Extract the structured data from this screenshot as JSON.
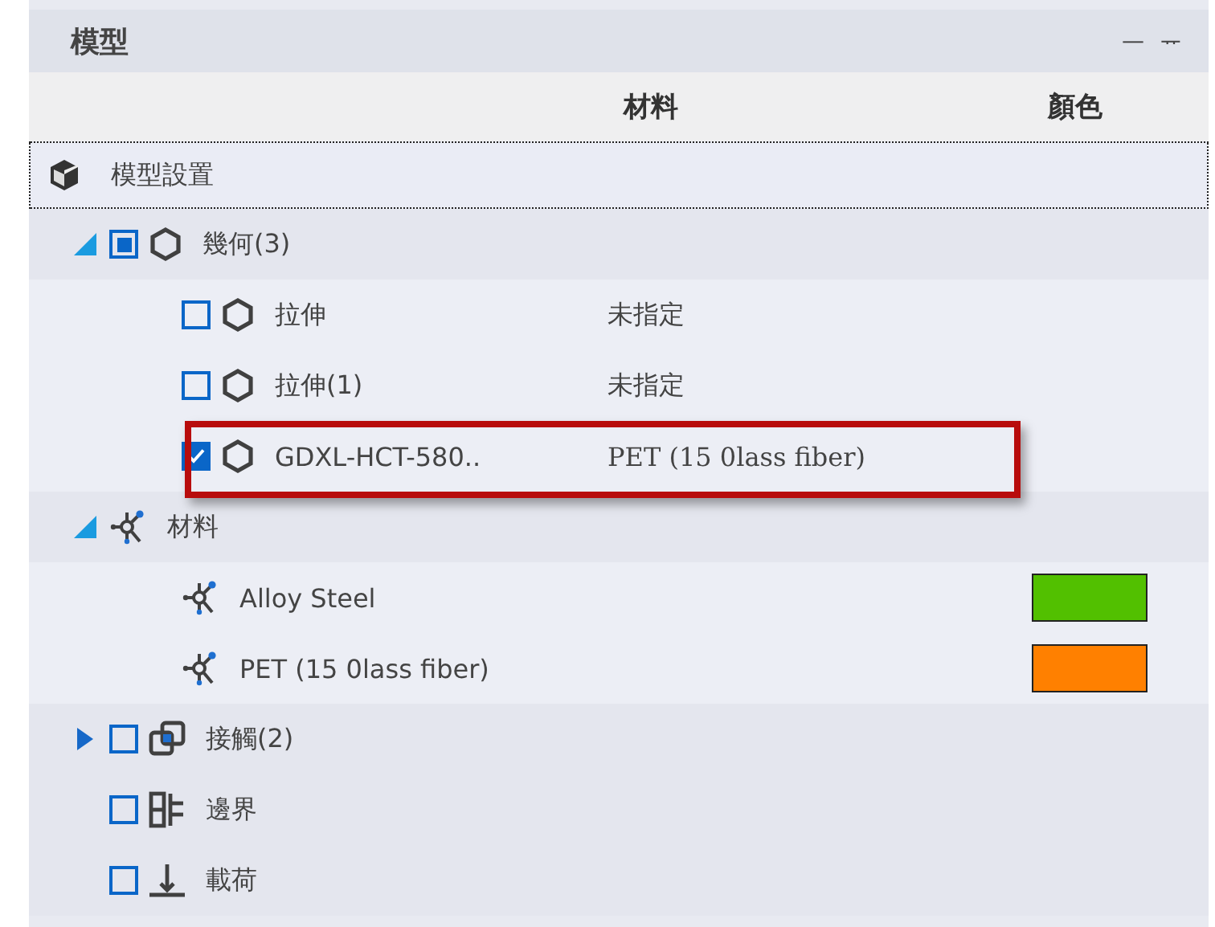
{
  "panel": {
    "title": "模型",
    "minimize_glyph": "—",
    "pin_glyph": "ᅲ"
  },
  "columns": [
    {
      "label": "材料"
    },
    {
      "label": "顏色"
    }
  ],
  "root": {
    "label": "模型設置",
    "selected": true
  },
  "tree": [
    {
      "label": "幾何(3)",
      "kind": "geometry",
      "checked": true,
      "partial": true,
      "expanded": true,
      "children": [
        {
          "label": "拉伸",
          "kind": "geometry",
          "checked": false,
          "partial": false,
          "material": "未指定",
          "highlighted": false
        },
        {
          "label": "拉伸(1)",
          "kind": "geometry",
          "checked": false,
          "partial": false,
          "material": "未指定",
          "highlighted": false
        },
        {
          "label": "GDXL-HCT-580..",
          "kind": "geometry",
          "checked": true,
          "partial": false,
          "material": "PET (15 0lass fiber)",
          "highlighted": true
        }
      ]
    },
    {
      "label": "材料",
      "kind": "material",
      "expanded": true,
      "children": [
        {
          "label": "Alloy Steel",
          "kind": "material",
          "color": "#52c000"
        },
        {
          "label": "PET (15 0lass fiber)",
          "kind": "material",
          "color": "#ff8000"
        }
      ]
    },
    {
      "label": "接觸(2)",
      "kind": "contact",
      "checked": false,
      "partial": false,
      "expanded": false
    },
    {
      "label": "邊界",
      "kind": "boundary",
      "checked": false,
      "partial": false
    },
    {
      "label": "載荷",
      "kind": "load",
      "checked": false,
      "partial": false
    }
  ]
}
